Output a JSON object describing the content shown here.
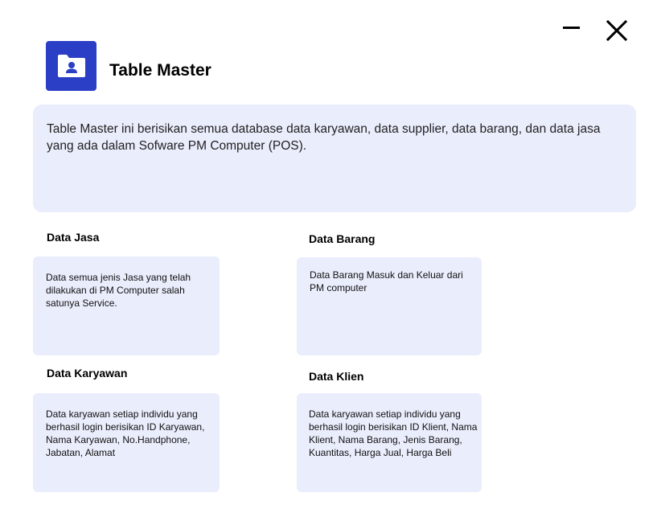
{
  "window": {
    "minimize_icon": "minimize-icon",
    "close_icon": "close-icon"
  },
  "header": {
    "icon": "folder-user-icon",
    "title": "Table Master",
    "accent_color": "#2a3fc6"
  },
  "description": "Table Master ini berisikan semua database data karyawan, data supplier, data barang, dan data jasa yang ada dalam Sofware PM Computer (POS).",
  "sections": {
    "jasa": {
      "title": "Data Jasa",
      "body": "Data semua jenis Jasa yang telah dilakukan di PM Computer salah satunya Service."
    },
    "barang": {
      "title": "Data Barang",
      "body": "Data Barang Masuk dan Keluar dari PM computer"
    },
    "karyawan": {
      "title": "Data Karyawan",
      "body": "Data karyawan setiap individu yang berhasil login berisikan ID Karyawan, Nama Karyawan, No.Handphone, Jabatan, Alamat"
    },
    "klien": {
      "title": "Data Klien",
      "body": "Data karyawan setiap individu yang berhasil login berisikan ID Klient, Nama Klient, Nama Barang, Jenis Barang, Kuantitas, Harga Jual, Harga Beli"
    }
  },
  "panel_color": "#eaedfc"
}
